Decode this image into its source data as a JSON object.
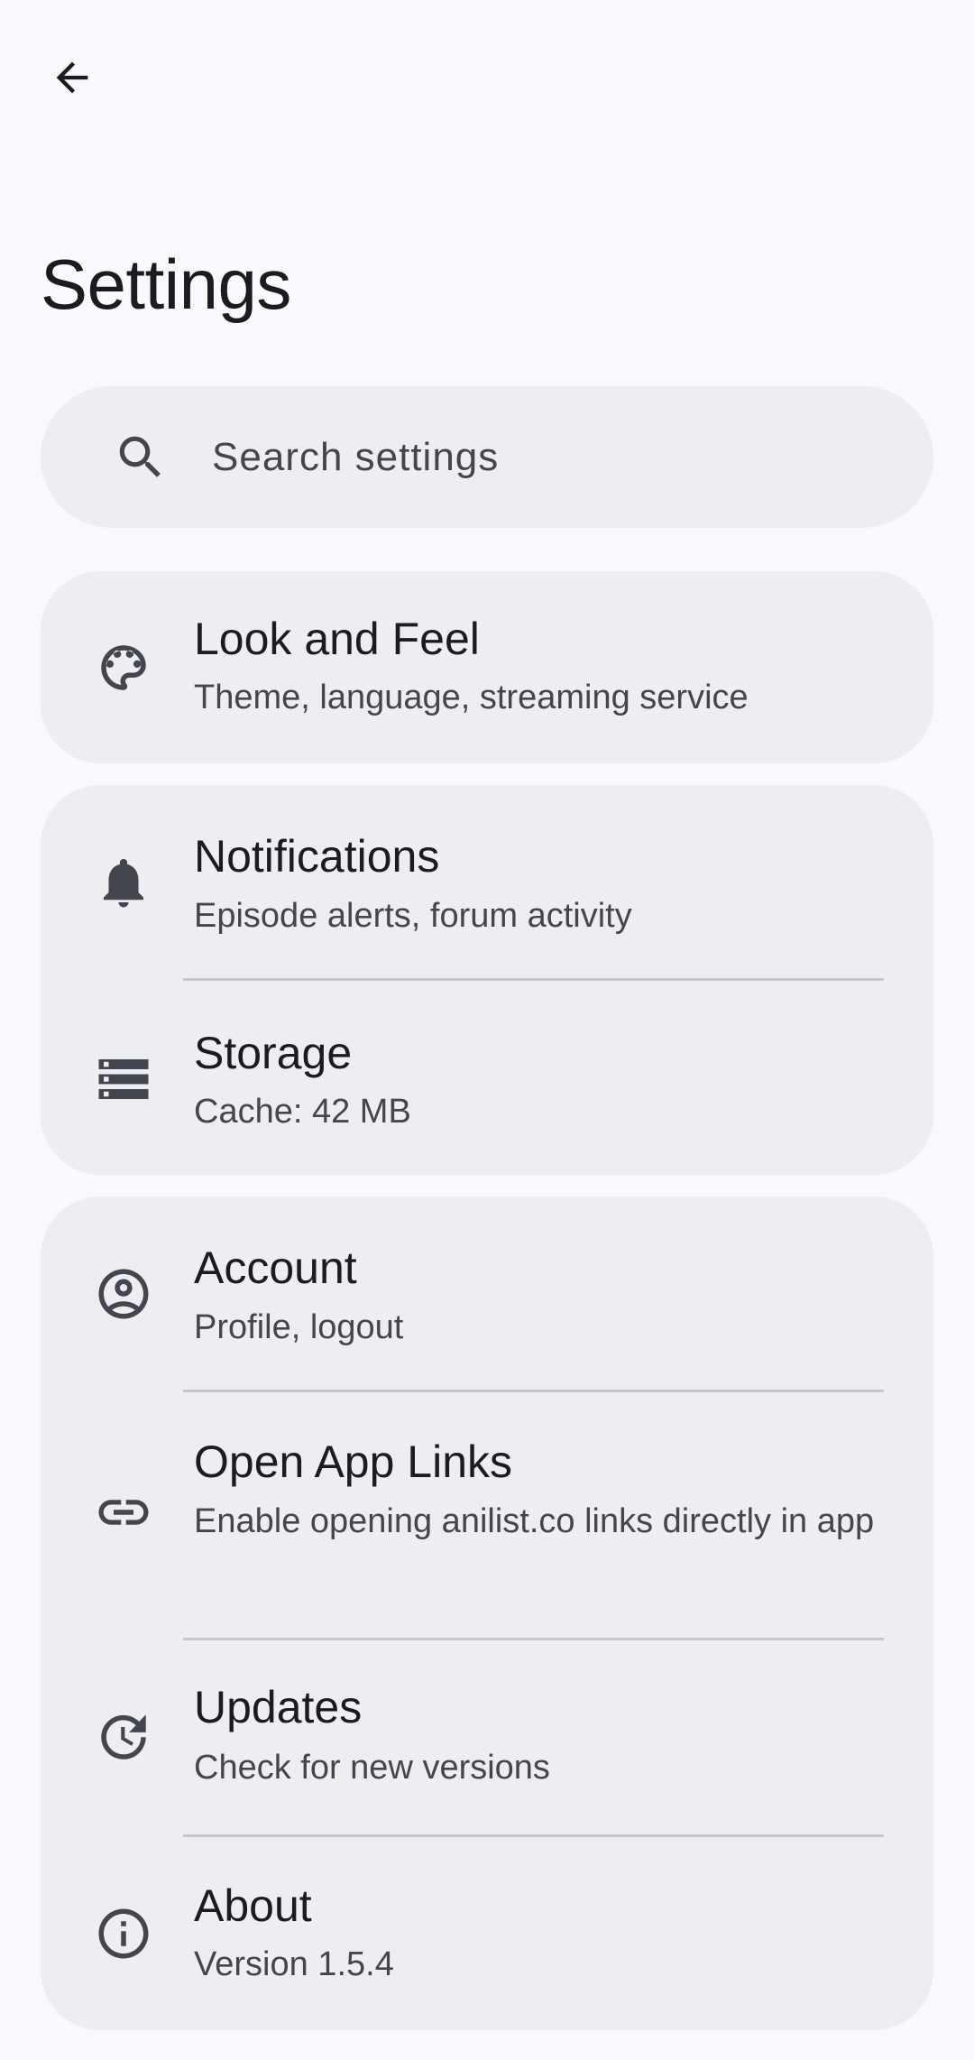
{
  "header": {
    "back_icon": "arrow-back-icon",
    "title": "Settings"
  },
  "search": {
    "icon": "search-icon",
    "placeholder": "Search settings"
  },
  "groups": [
    {
      "items": [
        {
          "icon": "palette-icon",
          "title": "Look and Feel",
          "subtitle": "Theme, language, streaming service"
        }
      ]
    },
    {
      "items": [
        {
          "icon": "bell-icon",
          "title": "Notifications",
          "subtitle": "Episode alerts, forum activity"
        },
        {
          "icon": "storage-icon",
          "title": "Storage",
          "subtitle": "Cache: 42 MB"
        }
      ]
    },
    {
      "items": [
        {
          "icon": "account-circle-icon",
          "title": "Account",
          "subtitle": "Profile, logout"
        },
        {
          "icon": "link-icon",
          "title": "Open App Links",
          "subtitle": "Enable opening anilist.co links directly in app"
        },
        {
          "icon": "update-icon",
          "title": "Updates",
          "subtitle": "Check for new versions"
        },
        {
          "icon": "info-icon",
          "title": "About",
          "subtitle": "Version 1.5.4"
        }
      ]
    }
  ],
  "colors": {
    "background": "#f8f9fe",
    "card": "#ededf2",
    "text_primary": "#1b1c21",
    "text_secondary": "#44464f",
    "divider": "#c6c6cd"
  }
}
